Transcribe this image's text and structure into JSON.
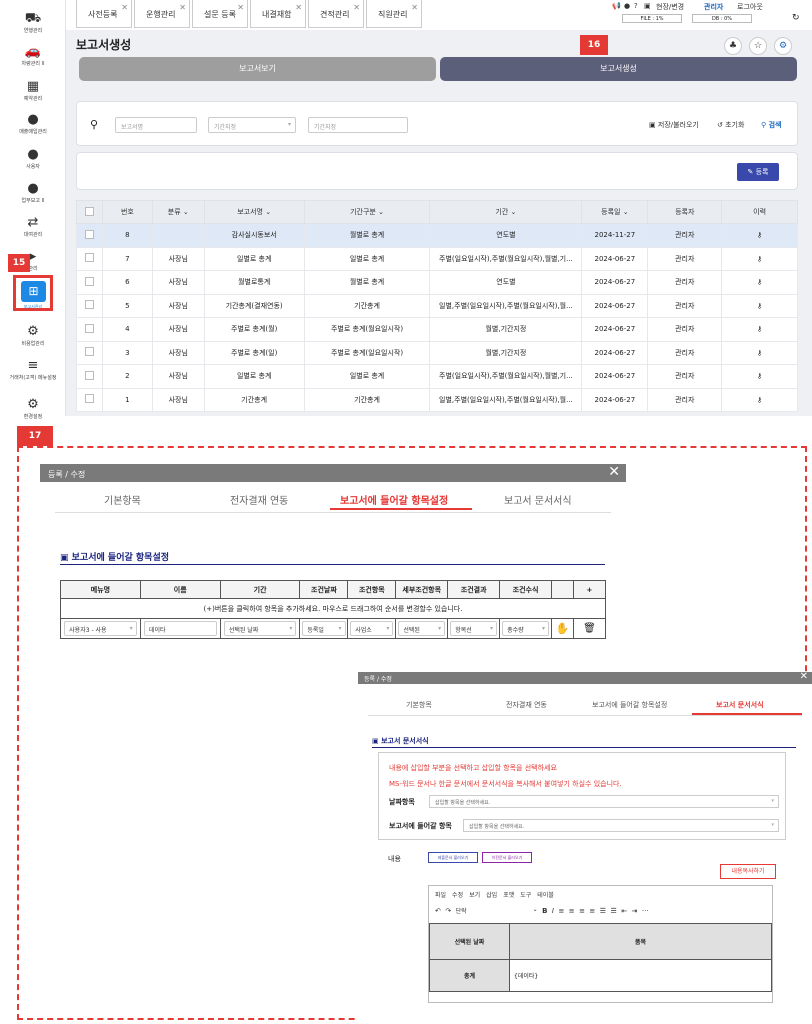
{
  "sidebar": {
    "items": [
      {
        "label": "연행관리",
        "icon": "truck-icon"
      },
      {
        "label": "차량관리 II",
        "icon": "car-icon"
      },
      {
        "label": "예약관리",
        "icon": "calendar-icon"
      },
      {
        "label": "매출매입관리",
        "icon": "user-money-icon"
      },
      {
        "label": "사용자",
        "icon": "users-icon"
      },
      {
        "label": "업무보고 II",
        "icon": "user-tie-icon"
      },
      {
        "label": "대여관리",
        "icon": "exchange-icon"
      },
      {
        "label": "관리",
        "icon": "play-icon"
      },
      {
        "label": "보고서관리",
        "icon": "report-icon"
      },
      {
        "label": "비용업관리",
        "icon": "cogs-icon"
      },
      {
        "label": "거래처(고객) 메뉴설정",
        "icon": "menu-icon"
      },
      {
        "label": "환경설정",
        "icon": "gear-icon"
      }
    ]
  },
  "tabs": [
    "사전등록",
    "운행관리",
    "설문 등록",
    "내결재함",
    "견적관리",
    "직원관리"
  ],
  "topbar": {
    "user": "현장/변경",
    "role": "관리자",
    "logout": "로그아웃",
    "file": "FILE : 1%",
    "db": "DB : 0%"
  },
  "page": {
    "title": "보고서생성",
    "seg_view": "보고서보기",
    "seg_create": "보고서생성"
  },
  "badges": {
    "b15": "15",
    "b16": "16",
    "b17": "17"
  },
  "search": {
    "placeholder": "보고서명",
    "period": "기간지정",
    "period2": "기간지정",
    "save": "저장/불러오기",
    "reset": "초기화",
    "search": "검색"
  },
  "register_label": "등록",
  "table": {
    "headers": [
      "번호",
      "분류",
      "보고서명",
      "기간구분",
      "기간",
      "등록일",
      "등록자",
      "이력"
    ],
    "rows": [
      [
        "8",
        "",
        "감사실시동보서",
        "월별로 총계",
        "연도별",
        "2024-11-27",
        "관리자"
      ],
      [
        "7",
        "사장님",
        "일별로 총계",
        "일별로 총계",
        "주별(일요일시작),주별(월요일시작),월별,기...",
        "2024-06-27",
        "관리자"
      ],
      [
        "6",
        "사장님",
        "월별로통계",
        "월별로 총계",
        "연도별",
        "2024-06-27",
        "관리자"
      ],
      [
        "5",
        "사장님",
        "기간총계(결재연동)",
        "기간총계",
        "일별,주별(일요일시작),주별(월요일시작),월...",
        "2024-06-27",
        "관리자"
      ],
      [
        "4",
        "사장님",
        "주별로 총계(월)",
        "주별로 총계(월요일시작)",
        "월별,기간지정",
        "2024-06-27",
        "관리자"
      ],
      [
        "3",
        "사장님",
        "주별로 총계(일)",
        "주별로 총계(일요일시작)",
        "월별,기간지정",
        "2024-06-27",
        "관리자"
      ],
      [
        "2",
        "사장님",
        "일별로 총계",
        "일별로 총계",
        "주별(일요일시작),주별(월요일시작),월별,기...",
        "2024-06-27",
        "관리자"
      ],
      [
        "1",
        "사장님",
        "기간총계",
        "기간총계",
        "일별,주별(일요일시작),주별(월요일시작),월...",
        "2024-06-27",
        "관리자"
      ]
    ]
  },
  "modal1": {
    "title": "등록 / 수정",
    "tabs": [
      "기본항목",
      "전자결재 연동",
      "보고서에 들어갈 항목설정",
      "보고서 문서서식"
    ],
    "section": "보고서에 들어갈 항목설정",
    "headers": [
      "메뉴명",
      "이름",
      "기간",
      "조건날짜",
      "조건항목",
      "세부조건항목",
      "조건결과",
      "조건수식",
      "",
      "+"
    ],
    "hint": "(+)버튼을 클릭하여 항목을 추가하세요. 마우스로 드래그하여 순서를 변경할수 있습니다.",
    "row": [
      "사용자3 - 사용",
      "데이타",
      "선택된 날짜",
      "등록일",
      "사업소",
      "선택된",
      "항목선",
      "총수량"
    ]
  },
  "modal2": {
    "title": "등록 / 수정",
    "tabs": [
      "기본항목",
      "전자결재 연동",
      "보고서에 들어갈 항목설정",
      "보고서 문서서식"
    ],
    "section": "보고서 문서서식",
    "notice1": "내용에 삽입할 부분을 선택하고 삽입할 항목을 선택하세요",
    "notice2": "MS-워드 문서나 한글 문서에서 문서서식을 복사해서 붙여넣기 하실수 있습니다.",
    "date_label": "날짜항목",
    "date_ph": "삽입할 항목을 선택하세요.",
    "item_label": "보고서에 들어갈 항목",
    "item_ph": "삽입할 항목을 선택하세요.",
    "content_label": "내용",
    "btn_load1": "레플문서 불러오기",
    "btn_load2": "이전문서 불러오기",
    "btn_copy": "내용복사하기",
    "menu": [
      "파일",
      "수정",
      "보기",
      "삽입",
      "포맷",
      "도구",
      "테이블"
    ],
    "para": "단락",
    "cells": [
      "선택된 날짜",
      "품목",
      "총계",
      "{데이타}"
    ]
  }
}
